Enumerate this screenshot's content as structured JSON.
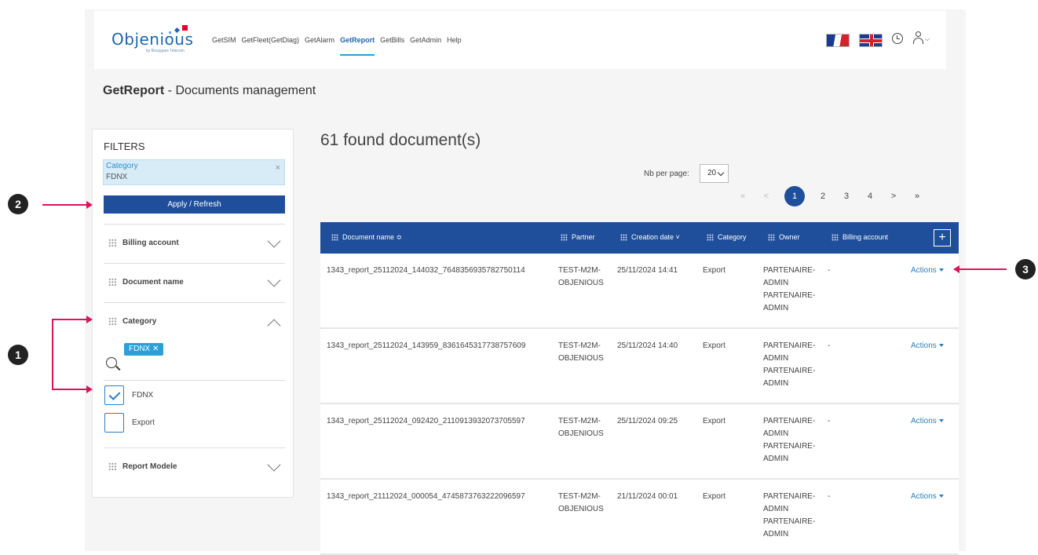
{
  "app": {
    "logo_text": "Objenious",
    "logo_sub": "by Bouygues Telecom"
  },
  "nav": {
    "items": [
      "GetSIM",
      "GetFleet(GetDiag)",
      "GetAlarm",
      "GetReport",
      "GetBills",
      "GetAdmin",
      "Help"
    ],
    "active": "GetReport"
  },
  "page": {
    "title_bold": "GetReport",
    "title_rest": " - Documents management"
  },
  "filters": {
    "title": "FILTERS",
    "active_chip": {
      "key": "Category",
      "value": "FDNX",
      "remove": "×"
    },
    "apply_label": "Apply / Refresh",
    "sections": {
      "billing": "Billing account",
      "document": "Document name",
      "category": "Category",
      "report": "Report Modele"
    },
    "category_tag": "FDNX ✕",
    "options": [
      {
        "label": "FDNX",
        "checked": true
      },
      {
        "label": "Export",
        "checked": false
      }
    ]
  },
  "results": {
    "count_text": "61 found document(s)",
    "nb_per_page_label": "Nb per page:",
    "nb_per_page_value": "20",
    "pagination": {
      "first": "«",
      "prev": "<",
      "pages": [
        "1",
        "2",
        "3",
        "4"
      ],
      "current": "1",
      "next": ">",
      "last": "»"
    }
  },
  "table": {
    "headers": {
      "document_name": "Document name ≎",
      "partner": "Partner",
      "creation_date": "Creation date ˅",
      "category": "Category",
      "owner": "Owner",
      "billing_account": "Billing account",
      "add": "+"
    },
    "rows": [
      {
        "name": "1343_report_25112024_144032_7648356935782750114",
        "partner": "TEST-M2M-OBJENIOUS",
        "date": "25/11/2024 14:41",
        "category": "Export",
        "owner": "PARTENAIRE-ADMIN PARTENAIRE-ADMIN",
        "billing": "-",
        "actions": "Actions"
      },
      {
        "name": "1343_report_25112024_143959_8361645317738757609",
        "partner": "TEST-M2M-OBJENIOUS",
        "date": "25/11/2024 14:40",
        "category": "Export",
        "owner": "PARTENAIRE-ADMIN PARTENAIRE-ADMIN",
        "billing": "-",
        "actions": "Actions"
      },
      {
        "name": "1343_report_25112024_092420_2110913932073705597",
        "partner": "TEST-M2M-OBJENIOUS",
        "date": "25/11/2024 09:25",
        "category": "Export",
        "owner": "PARTENAIRE-ADMIN PARTENAIRE-ADMIN",
        "billing": "-",
        "actions": "Actions"
      },
      {
        "name": "1343_report_21112024_000054_4745873763222096597",
        "partner": "TEST-M2M-OBJENIOUS",
        "date": "21/11/2024 00:01",
        "category": "Export",
        "owner": "PARTENAIRE-ADMIN PARTENAIRE-ADMIN",
        "billing": "-",
        "actions": "Actions"
      }
    ]
  },
  "callouts": [
    "1",
    "2",
    "3"
  ],
  "colors": {
    "primary": "#1f4f9a",
    "accent": "#2b9fd6",
    "annotation": "#e0115a"
  }
}
